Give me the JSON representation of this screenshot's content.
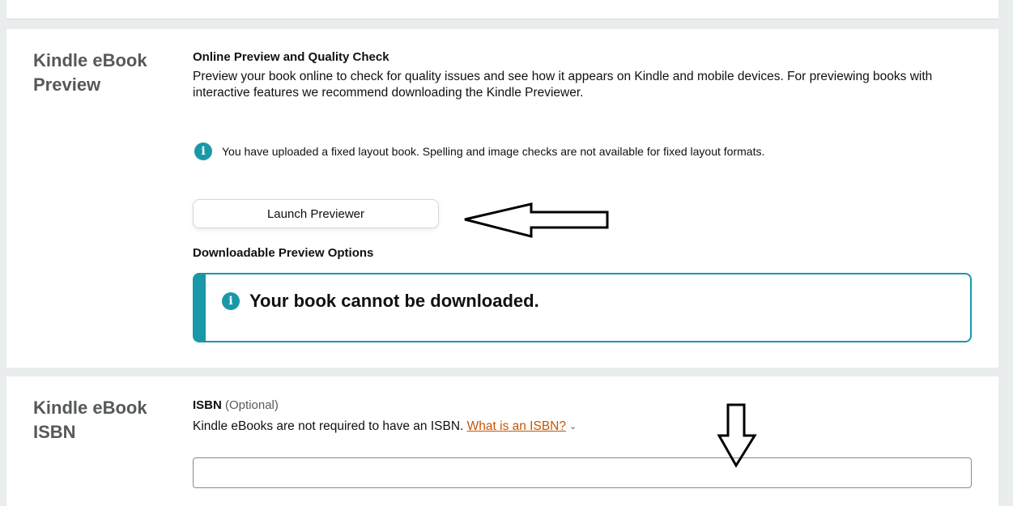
{
  "preview_section": {
    "title": "Kindle eBook Preview",
    "online_heading": "Online Preview and Quality Check",
    "online_description": "Preview your book online to check for quality issues and see how it appears on Kindle and mobile devices. For previewing books with interactive features we recommend downloading the Kindle Previewer.",
    "info_message": "You have uploaded a fixed layout book. Spelling and image checks are not available for fixed layout formats.",
    "launch_button_label": "Launch Previewer",
    "downloadable_heading": "Downloadable Preview Options",
    "alert_message": "Your book cannot be downloaded."
  },
  "isbn_section": {
    "title": "Kindle eBook ISBN",
    "label": "ISBN",
    "optional_text": "(Optional)",
    "description": "Kindle eBooks are not required to have an ISBN.",
    "help_link": "What is an ISBN?",
    "input_value": "",
    "input_placeholder": ""
  },
  "icons": {
    "info": "info-icon",
    "chevron": "chevron-down-icon",
    "annotation_left": "left-arrow-annotation",
    "annotation_down": "down-arrow-annotation"
  },
  "colors": {
    "info_teal": "#1a98a8",
    "link": "#c45500",
    "section_title": "#565959",
    "background": "#eaeded"
  }
}
